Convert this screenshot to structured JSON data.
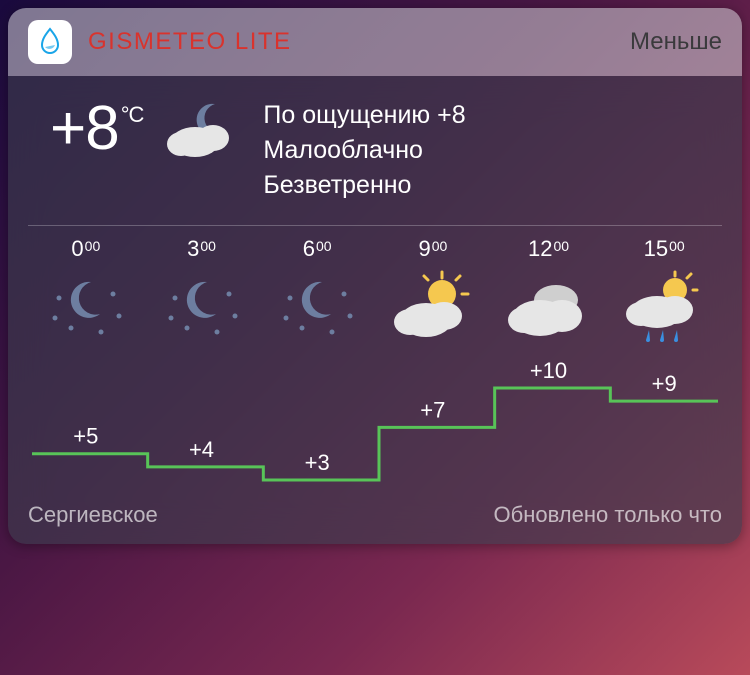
{
  "header": {
    "app_name": "GISMETEO LITE",
    "collapse_label": "Меньше"
  },
  "current": {
    "temp_value": "+8",
    "unit": "°C",
    "feels_label": "По ощущению +8",
    "cond1": "Малооблачно",
    "cond2": "Безветренно"
  },
  "forecast": [
    {
      "h": "0",
      "m": "00",
      "icon": "night-clear",
      "temp": "+5"
    },
    {
      "h": "3",
      "m": "00",
      "icon": "night-clear",
      "temp": "+4"
    },
    {
      "h": "6",
      "m": "00",
      "icon": "night-clear",
      "temp": "+3"
    },
    {
      "h": "9",
      "m": "00",
      "icon": "partly-sunny",
      "temp": "+7"
    },
    {
      "h": "12",
      "m": "00",
      "icon": "cloudy",
      "temp": "+10"
    },
    {
      "h": "15",
      "m": "00",
      "icon": "rain-sun",
      "temp": "+9"
    }
  ],
  "chart_data": {
    "type": "line",
    "categories": [
      "0:00",
      "3:00",
      "6:00",
      "9:00",
      "12:00",
      "15:00"
    ],
    "values": [
      5,
      4,
      3,
      7,
      10,
      9
    ],
    "ylabel": "°C",
    "ylim": [
      3,
      10
    ]
  },
  "footer": {
    "location": "Сергиевское",
    "updated": "Обновлено только что"
  },
  "colors": {
    "accent_red": "#d9332d",
    "chart_line": "#58c458",
    "moon": "#6d7ea0",
    "cloud": "#e6e6e6",
    "sun": "#f5c84f",
    "rain": "#3a8fe0"
  }
}
